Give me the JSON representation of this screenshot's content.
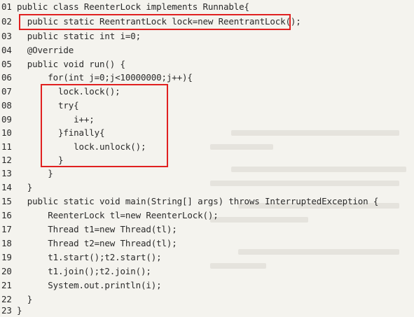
{
  "code": {
    "lines": [
      {
        "num": "01",
        "text": "public class ReenterLock implements Runnable{"
      },
      {
        "num": "02",
        "text": "  public static ReentrantLock lock=new ReentrantLock();"
      },
      {
        "num": "03",
        "text": "  public static int i=0;"
      },
      {
        "num": "04",
        "text": "  @Override"
      },
      {
        "num": "05",
        "text": "  public void run() {"
      },
      {
        "num": "06",
        "text": "      for(int j=0;j<10000000;j++){"
      },
      {
        "num": "07",
        "text": "        lock.lock();"
      },
      {
        "num": "08",
        "text": "        try{"
      },
      {
        "num": "09",
        "text": "           i++;"
      },
      {
        "num": "10",
        "text": "        }finally{"
      },
      {
        "num": "11",
        "text": "           lock.unlock();"
      },
      {
        "num": "12",
        "text": "        }"
      },
      {
        "num": "13",
        "text": "      }"
      },
      {
        "num": "14",
        "text": "  }"
      },
      {
        "num": "15",
        "text": "  public static void main(String[] args) throws InterruptedException {"
      },
      {
        "num": "16",
        "text": "      ReenterLock tl=new ReenterLock();"
      },
      {
        "num": "17",
        "text": "      Thread t1=new Thread(tl);"
      },
      {
        "num": "18",
        "text": "      Thread t2=new Thread(tl);"
      },
      {
        "num": "19",
        "text": "      t1.start();t2.start();"
      },
      {
        "num": "20",
        "text": "      t1.join();t2.join();"
      },
      {
        "num": "21",
        "text": "      System.out.println(i);"
      },
      {
        "num": "22",
        "text": "  }"
      },
      {
        "num": "23",
        "text": "}"
      }
    ]
  },
  "highlight_color": "#e02020"
}
